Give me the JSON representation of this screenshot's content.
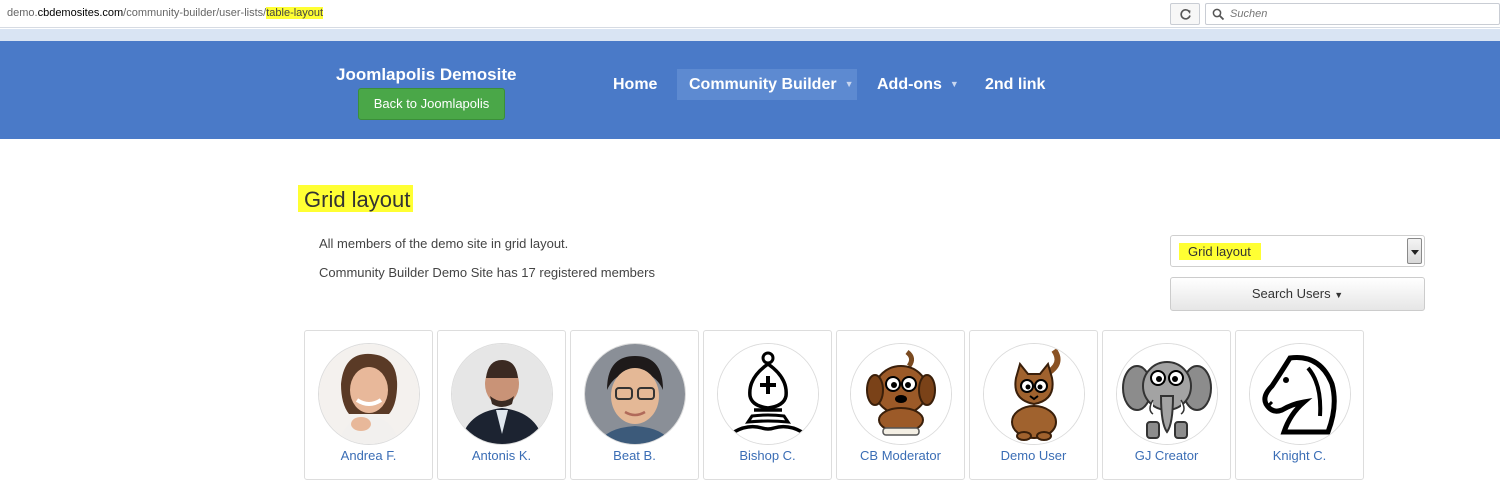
{
  "browser": {
    "url_host_prefix": "demo.",
    "url_domain": "cbdemosites.com",
    "url_path": "/community-builder/user-lists/",
    "url_highlight": "table-layout",
    "search_placeholder": "Suchen"
  },
  "site": {
    "title": "Joomlapolis Demosite",
    "back_button": "Back to Joomlapolis",
    "nav": {
      "home": "Home",
      "community_builder": "Community Builder",
      "addons": "Add-ons",
      "second_link": "2nd link"
    }
  },
  "page": {
    "title": "Grid layout",
    "description": "All members of the demo site in grid layout.",
    "member_count_text": "Community Builder Demo Site has 17 registered members",
    "list_select_value": "Grid layout",
    "search_users_label": "Search Users"
  },
  "users": [
    {
      "name": "Andrea F.",
      "avatar": "woman-photo-avatar"
    },
    {
      "name": "Antonis K.",
      "avatar": "man-in-suit-photo-avatar"
    },
    {
      "name": "Beat B.",
      "avatar": "man-with-glasses-photo-avatar"
    },
    {
      "name": "Bishop C.",
      "avatar": "chess-bishop-icon"
    },
    {
      "name": "CB Moderator",
      "avatar": "cartoon-dog-icon"
    },
    {
      "name": "Demo User",
      "avatar": "cartoon-cat-icon"
    },
    {
      "name": "GJ Creator",
      "avatar": "cartoon-elephant-icon"
    },
    {
      "name": "Knight C.",
      "avatar": "chess-knight-icon"
    }
  ],
  "colors": {
    "header_bg": "#4a7ac8",
    "active_nav_bg": "#5d8ad1",
    "back_button_bg": "#4aa748",
    "highlight": "#ffff33",
    "link": "#3a6db5"
  }
}
